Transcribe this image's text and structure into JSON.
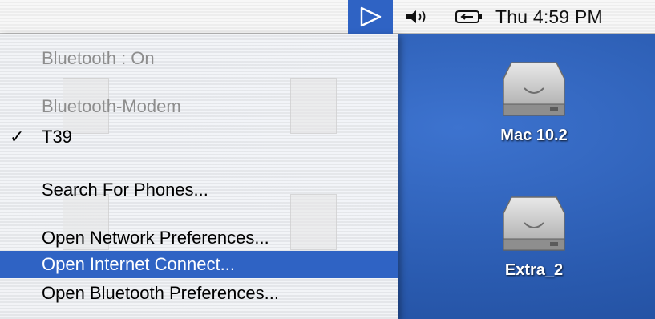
{
  "menubar": {
    "clock": "Thu 4:59 PM",
    "extras": {
      "bluetooth": "bluetooth-icon",
      "volume": "volume-icon",
      "battery": "battery-icon"
    }
  },
  "bluetooth_menu": {
    "items": [
      {
        "label": "Bluetooth : On",
        "enabled": false,
        "checked": false,
        "selected": false
      },
      {
        "label": "Bluetooth-Modem",
        "enabled": false,
        "checked": false,
        "selected": false
      },
      {
        "label": "T39",
        "enabled": true,
        "checked": true,
        "selected": false
      },
      {
        "label": "Search For Phones...",
        "enabled": true,
        "checked": false,
        "selected": false
      },
      {
        "label": "Open Network Preferences...",
        "enabled": true,
        "checked": false,
        "selected": false
      },
      {
        "label": "Open Internet Connect...",
        "enabled": true,
        "checked": false,
        "selected": true
      },
      {
        "label": "Open Bluetooth Preferences...",
        "enabled": true,
        "checked": false,
        "selected": false
      }
    ],
    "check_glyph": "✓"
  },
  "desktop": {
    "icons": [
      {
        "label": "Mac 10.2",
        "icon": "hard-drive-icon"
      },
      {
        "label": "Extra_2",
        "icon": "hard-drive-icon"
      }
    ]
  },
  "colors": {
    "selection": "#2f63c4",
    "desktop": "#2a5bb0",
    "disabled_text": "#8d8d8d"
  }
}
